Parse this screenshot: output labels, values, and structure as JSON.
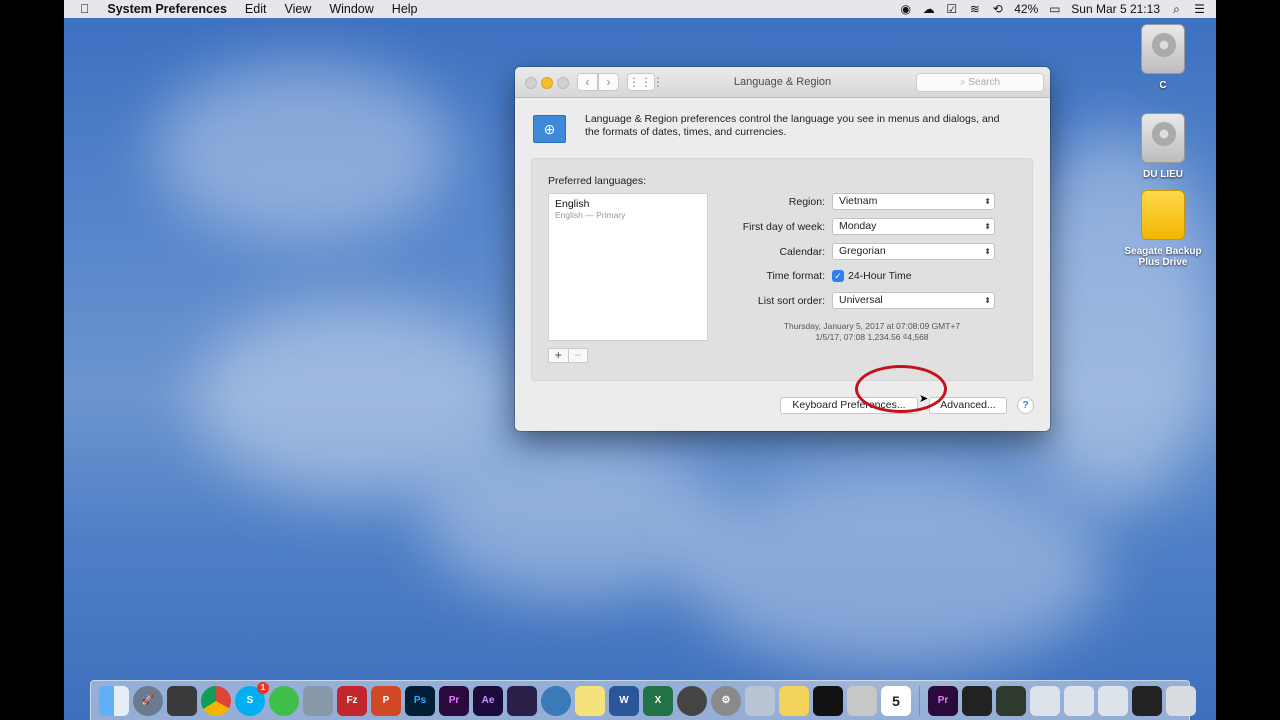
{
  "menubar": {
    "apple": "",
    "app_name": "System Preferences",
    "items": [
      "Edit",
      "View",
      "Window",
      "Help"
    ],
    "battery": "42%",
    "clock": "Sun Mar 5  21:13"
  },
  "desktop": {
    "icons": [
      "C",
      "DU LIEU",
      "Seagate Backup Plus Drive"
    ]
  },
  "window": {
    "title": "Language & Region",
    "search_placeholder": "Search",
    "description": "Language & Region preferences control the language you see in menus and dialogs, and the formats of dates, times, and currencies.",
    "preferred_label": "Preferred languages:",
    "languages": [
      {
        "name": "English",
        "sub": "English — Primary"
      }
    ],
    "add": "+",
    "remove": "−",
    "region_label": "Region:",
    "region_value": "Vietnam",
    "first_day_label": "First day of week:",
    "first_day_value": "Monday",
    "calendar_label": "Calendar:",
    "calendar_value": "Gregorian",
    "time_format_label": "Time format:",
    "time_format_value": "24-Hour Time",
    "time_format_checked": true,
    "sort_order_label": "List sort order:",
    "sort_order_value": "Universal",
    "sample_line1": "Thursday, January 5, 2017 at 07:08:09 GMT+7",
    "sample_line2": "1/5/17, 07:08     1,234.56     ₫4,568",
    "keyboard_button": "Keyboard Preferences...",
    "advanced_button": "Advanced...",
    "help": "?"
  },
  "dock": {
    "labels": [
      "Ps",
      "Pr",
      "Ae",
      "Pr"
    ],
    "calendar_day": "5",
    "skype_badge": "1"
  },
  "colors": {
    "accent": "#2f7ff0",
    "annotation": "#c4121c",
    "minimize": "#f5be2f"
  }
}
